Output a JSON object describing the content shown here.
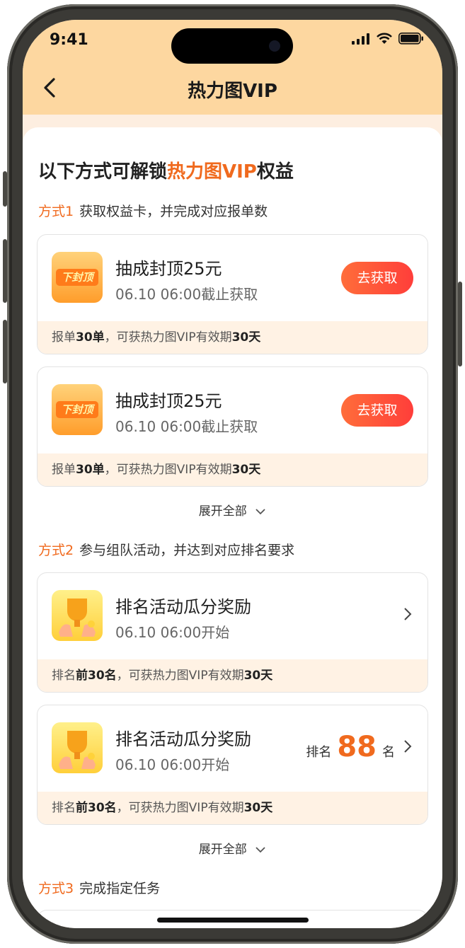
{
  "status": {
    "time": "9:41"
  },
  "nav": {
    "title": "热力图VIP"
  },
  "headline": {
    "pre": "以下方式可解锁",
    "highlight": "热力图VIP",
    "post": "权益"
  },
  "method1": {
    "tag": "方式1",
    "text": "获取权益卡，并完成对应报单数"
  },
  "method2": {
    "tag": "方式2",
    "text": "参与组队活动，并达到对应排名要求"
  },
  "method3": {
    "tag": "方式3",
    "text": "完成指定任务"
  },
  "cards1": [
    {
      "icon_text": "下封顶",
      "title": "抽成封顶25元",
      "sub": "06.10 06:00截止获取",
      "button": "去获取",
      "foot_a": "报单",
      "foot_b": "30单",
      "foot_c": "，可获热力图VIP有效期",
      "foot_d": "30天"
    },
    {
      "icon_text": "下封顶",
      "title": "抽成封顶25元",
      "sub": "06.10 06:00截止获取",
      "button": "去获取",
      "foot_a": "报单",
      "foot_b": "30单",
      "foot_c": "，可获热力图VIP有效期",
      "foot_d": "30天"
    }
  ],
  "cards2": [
    {
      "title": "排名活动瓜分奖励",
      "sub": "06.10 06:00开始",
      "foot_a": "排名",
      "foot_b": "前30名",
      "foot_c": "，可获热力图VIP有效期",
      "foot_d": "30天"
    },
    {
      "title": "排名活动瓜分奖励",
      "sub": "06.10 06:00开始",
      "rank_pre": "排名",
      "rank_num": "88",
      "rank_post": "名",
      "foot_a": "排名",
      "foot_b": "前30名",
      "foot_c": "，可获热力图VIP有效期",
      "foot_d": "30天"
    }
  ],
  "expand_label": "展开全部",
  "colors": {
    "accent": "#f06a1e",
    "header": "#fdd7a0",
    "button": "#ff4f3a"
  },
  "icons": [
    "back-arrow-icon",
    "chevron-right-icon",
    "chevron-down-icon",
    "trophy-icon",
    "cap-badge-icon"
  ]
}
